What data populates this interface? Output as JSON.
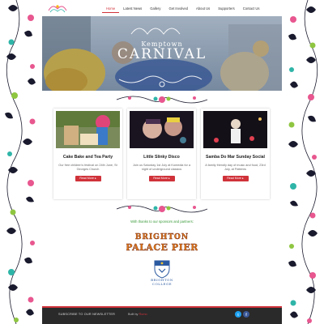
{
  "header": {
    "logo_icon": "carnival-logo-icon",
    "nav": [
      {
        "label": "Home",
        "active": true
      },
      {
        "label": "Latest News"
      },
      {
        "label": "Gallery"
      },
      {
        "label": "Get Involved"
      },
      {
        "label": "About Us"
      },
      {
        "label": "Supporters"
      },
      {
        "label": "Contact Us"
      }
    ]
  },
  "hero": {
    "small_title": "Kemptown",
    "big_title": "CARNIVAL"
  },
  "events": [
    {
      "title": "Cake Bake and Tea Party",
      "text": "Our free children's festival on 24th June, St Georges Church",
      "button": "Read More ▸"
    },
    {
      "title": "Little Slinky Disco",
      "text": "Join us Saturday 1st July at Komedia for a night of underground classics",
      "button": "Read More ▸"
    },
    {
      "title": "Samba Do Mar Sunday Social",
      "text": "A family friendly day of music and food, 23rd July, at Patterns",
      "button": "Read More ▸"
    }
  ],
  "sponsors": {
    "thanks": "With thanks to our sponsors and partners:",
    "pier_line1": "BRIGHTON",
    "pier_line2": "PALACE PIER",
    "college_line1": "BRIGHTON",
    "college_line2": "COLLEGE"
  },
  "footer": {
    "newsletter": "SUBSCRIBE TO OUR NEWSLETTER",
    "built_prefix": "Built by ",
    "built_by": "Rumo",
    "twitter_icon": "twitter-icon",
    "facebook_icon": "facebook-icon"
  },
  "colors": {
    "accent": "#d0323a",
    "green": "#3a9a3a",
    "footer_bg": "#2a2a2a"
  }
}
